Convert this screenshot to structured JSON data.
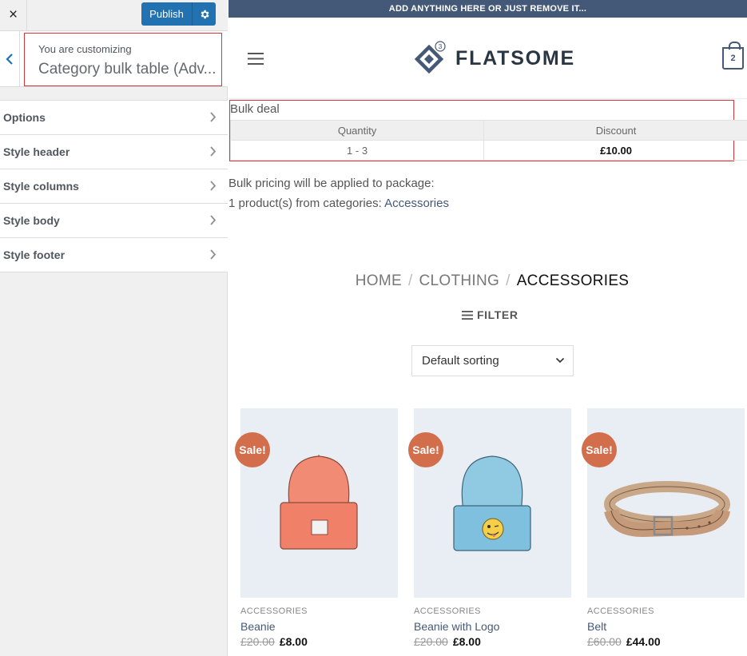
{
  "customizer": {
    "close_icon": "×",
    "publish_label": "Publish",
    "customizing_label": "You are customizing",
    "customizing_title": "Category bulk table (Adv...",
    "menu": [
      {
        "label": "Options"
      },
      {
        "label": "Style header"
      },
      {
        "label": "Style columns"
      },
      {
        "label": "Style body"
      },
      {
        "label": "Style footer"
      }
    ]
  },
  "store": {
    "top_bar": "ADD ANYTHING HERE OR JUST REMOVE IT...",
    "logo_text": "FLATSOME",
    "logo_badge": "3",
    "cart_count": "2",
    "bulk": {
      "title": "Bulk deal",
      "headers": [
        "Quantity",
        "Discount"
      ],
      "rows": [
        [
          "1 - 3",
          "£10.00"
        ]
      ]
    },
    "package_line1": "Bulk pricing will be applied to package:",
    "package_line2_prefix": "1 product(s) from categories: ",
    "package_link": "Accessories",
    "breadcrumb": [
      "HOME",
      "CLOTHING",
      "ACCESSORIES"
    ],
    "breadcrumb_sep": "/",
    "filter_label": "FILTER",
    "sort_label": "Default sorting",
    "products": [
      {
        "sale": "Sale!",
        "category": "ACCESSORIES",
        "name": "Beanie",
        "old_price": "£20.00",
        "price": "£8.00"
      },
      {
        "sale": "Sale!",
        "category": "ACCESSORIES",
        "name": "Beanie with Logo",
        "old_price": "£20.00",
        "price": "£8.00"
      },
      {
        "sale": "Sale!",
        "category": "ACCESSORIES",
        "name": "Belt",
        "old_price": "£60.00",
        "price": "£44.00"
      }
    ]
  },
  "colors": {
    "accent": "#2271b1",
    "topbar": "#445878",
    "sale_badge": "#d26e4b",
    "highlight_border": "#d63638"
  },
  "icons": [
    "close-icon",
    "gear-icon",
    "chevron-left-icon",
    "chevron-right-icon",
    "hamburger-icon",
    "cart-icon",
    "filter-icon",
    "chevron-down-icon"
  ]
}
